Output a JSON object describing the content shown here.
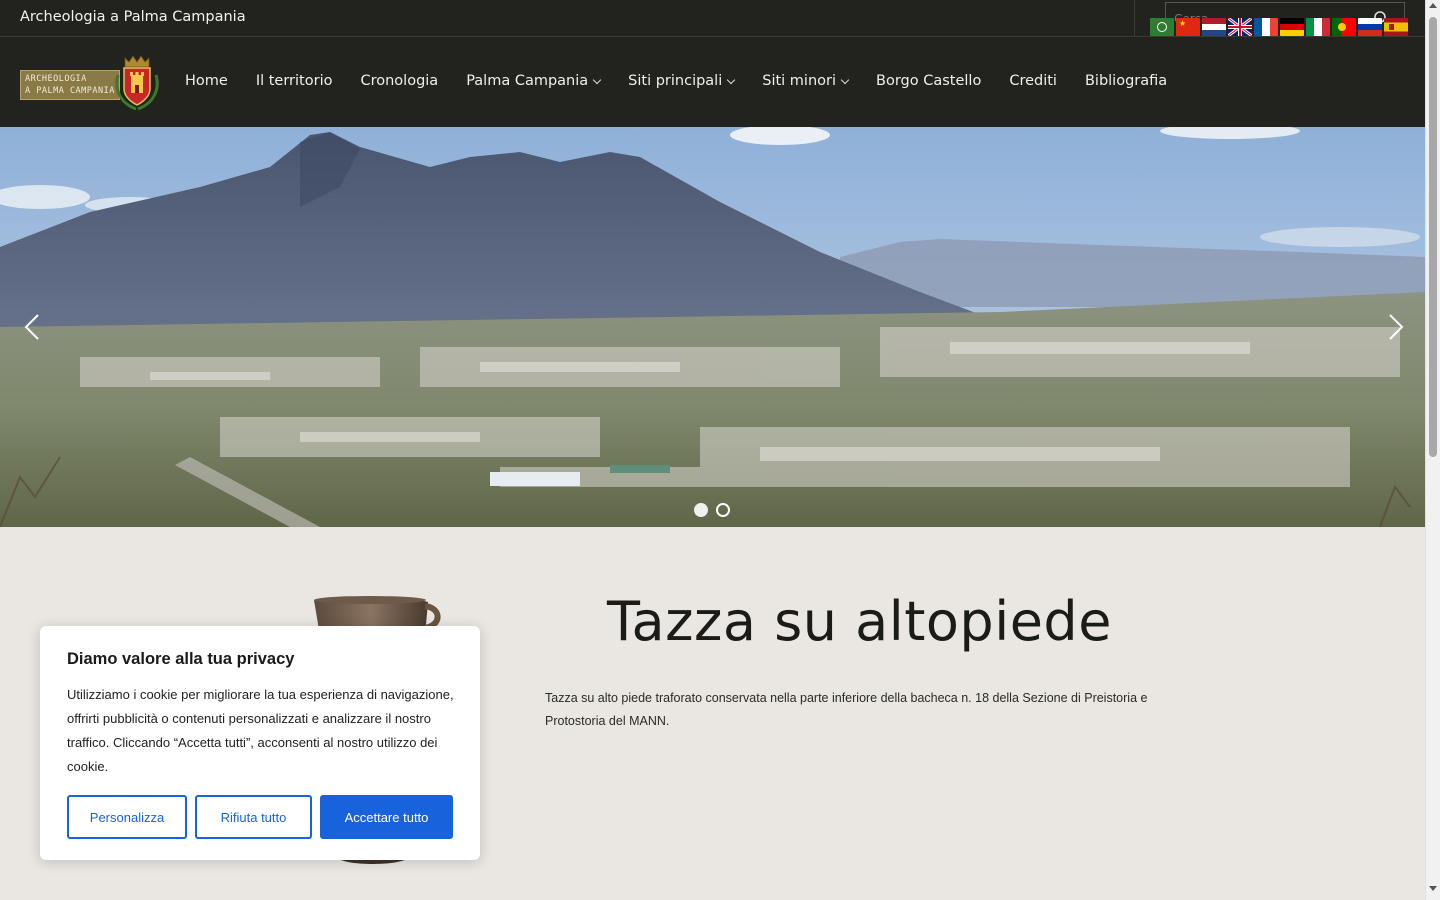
{
  "topbar": {
    "site_title": "Archeologia a Palma Campania",
    "search_placeholder": "Cerca...",
    "flags": [
      "arabic-flag-icon",
      "chinese-flag-icon",
      "dutch-flag-icon",
      "english-flag-icon",
      "french-flag-icon",
      "german-flag-icon",
      "italian-flag-icon",
      "portuguese-flag-icon",
      "russian-flag-icon",
      "spanish-flag-icon"
    ]
  },
  "logo": {
    "line1": "ARCHEOLOGIA",
    "line2": "A PALMA CAMPANIA"
  },
  "nav": {
    "items": [
      {
        "label": "Home",
        "dropdown": false
      },
      {
        "label": "Il territorio",
        "dropdown": false
      },
      {
        "label": "Cronologia",
        "dropdown": false
      },
      {
        "label": "Palma Campania",
        "dropdown": true
      },
      {
        "label": "Siti principali",
        "dropdown": true
      },
      {
        "label": "Siti minori",
        "dropdown": true
      },
      {
        "label": "Borgo Castello",
        "dropdown": false
      },
      {
        "label": "Crediti",
        "dropdown": false
      },
      {
        "label": "Bibliografia",
        "dropdown": false
      }
    ]
  },
  "slider": {
    "slide_count": 2,
    "active_slide": 1
  },
  "main": {
    "heading": "Tazza su altopiede",
    "description": "Tazza su alto piede traforato conservata nella parte inferiore della bacheca n. 18 della Sezione di Preistoria e Protostoria del MANN."
  },
  "cookie": {
    "title": "Diamo valore alla tua privacy",
    "text": "Utilizziamo i cookie per migliorare la tua esperienza di navigazione, offrirti pubblicità o contenuti personalizzati e analizzare il nostro traffico. Cliccando “Accetta tutti”, acconsenti al nostro utilizzo dei cookie.",
    "customize_label": "Personalizza",
    "reject_label": "Rifiuta tutto",
    "accept_label": "Accettare tutto"
  },
  "colors": {
    "header_bg": "#22221e",
    "content_bg": "#eae7e2",
    "accent_blue": "#1863dc",
    "logo_gold": "#8a7a48"
  }
}
